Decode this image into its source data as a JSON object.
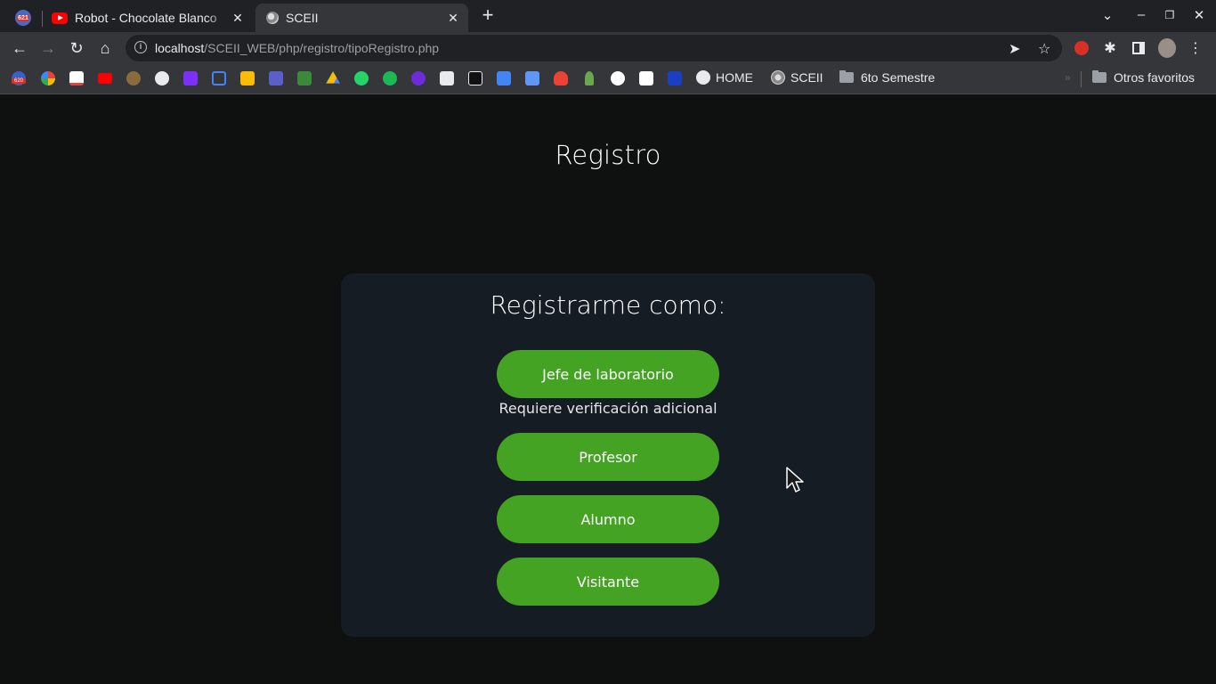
{
  "browser": {
    "tabs": [
      {
        "label": "",
        "badge": "621",
        "active": false
      },
      {
        "label": "Robot - Chocolate Blanco",
        "active": false
      },
      {
        "label": "SCEII",
        "active": true
      }
    ],
    "url_host": "localhost",
    "url_path": "/SCEII_WEB/php/registro/tipoRegistro.php",
    "bookmarks": [
      {
        "label": "HOME",
        "icon": "globe-icon"
      },
      {
        "label": "SCEII",
        "icon": "sceii-icon"
      },
      {
        "label": "6to Semestre",
        "icon": "folder-icon"
      }
    ],
    "other_bookmarks": "Otros favoritos",
    "bookmark_badge": "620"
  },
  "page": {
    "title": "Registro",
    "card_title": "Registrarme como:",
    "buttons": {
      "jefe": "Jefe de laboratorio",
      "profesor": "Profesor",
      "alumno": "Alumno",
      "visitante": "Visitante"
    },
    "jefe_note": "Requiere verificación adicional"
  },
  "colors": {
    "accent_green": "#45a324",
    "card_bg": "#161c24",
    "page_bg": "#0f1111"
  }
}
